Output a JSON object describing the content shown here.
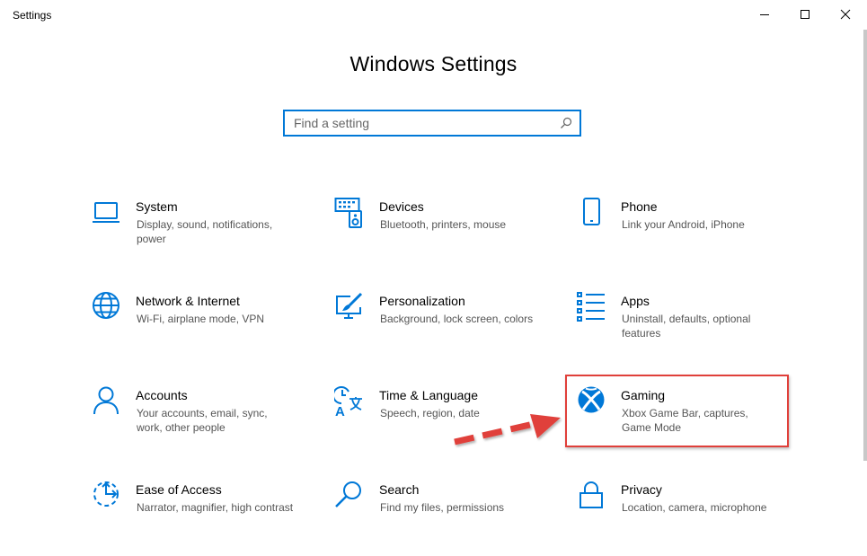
{
  "window": {
    "app_title": "Settings",
    "controls": [
      "minimize",
      "maximize",
      "close"
    ]
  },
  "header": {
    "title": "Windows Settings"
  },
  "search": {
    "placeholder": "Find a setting",
    "value": ""
  },
  "tiles": [
    {
      "name": "System",
      "desc": "Display, sound, notifications, power",
      "icon": "laptop-icon"
    },
    {
      "name": "Devices",
      "desc": "Bluetooth, printers, mouse",
      "icon": "keyboard-speaker-icon"
    },
    {
      "name": "Phone",
      "desc": "Link your Android, iPhone",
      "icon": "phone-icon"
    },
    {
      "name": "Network & Internet",
      "desc": "Wi-Fi, airplane mode, VPN",
      "icon": "globe-icon"
    },
    {
      "name": "Personalization",
      "desc": "Background, lock screen, colors",
      "icon": "paint-screen-icon"
    },
    {
      "name": "Apps",
      "desc": "Uninstall, defaults, optional features",
      "icon": "apps-list-icon"
    },
    {
      "name": "Accounts",
      "desc": "Your accounts, email, sync, work, other people",
      "icon": "person-icon"
    },
    {
      "name": "Time & Language",
      "desc": "Speech, region, date",
      "icon": "clock-language-icon"
    },
    {
      "name": "Gaming",
      "desc": "Xbox Game Bar, captures, Game Mode",
      "icon": "xbox-icon"
    },
    {
      "name": "Ease of Access",
      "desc": "Narrator, magnifier, high contrast",
      "icon": "ease-of-access-icon"
    },
    {
      "name": "Search",
      "desc": "Find my files, permissions",
      "icon": "search-icon"
    },
    {
      "name": "Privacy",
      "desc": "Location, camera, microphone",
      "icon": "lock-icon"
    }
  ],
  "colors": {
    "accent": "#0078d7",
    "highlight": "#e0403a",
    "desc_text": "#555555"
  }
}
